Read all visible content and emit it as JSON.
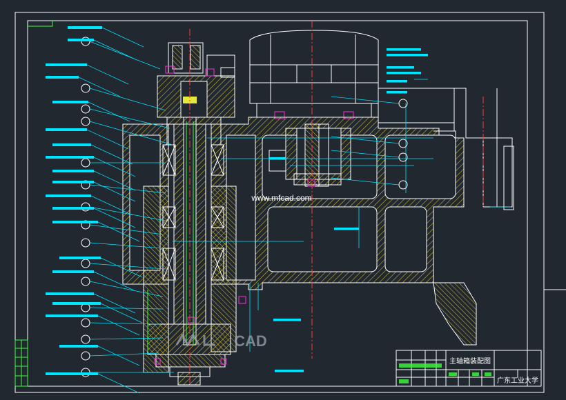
{
  "drawing": {
    "watermark_url": "www.mfcad.com",
    "watermark_brand": "CAD",
    "title_block": {
      "drawing_title": "主轴箱装配图",
      "organization": "广东工业大学"
    }
  },
  "colors": {
    "background": "#212830",
    "frame": "#ffffff",
    "outline": "#ffffff",
    "hatch": "#d8c03a",
    "centerline": "#ff3a3a",
    "leader": "#00e5ff",
    "label_box": "#00e5ff",
    "magenta": "#ff2bd6",
    "green": "#3cff3c",
    "yellow_fill": "#e8e83a"
  }
}
